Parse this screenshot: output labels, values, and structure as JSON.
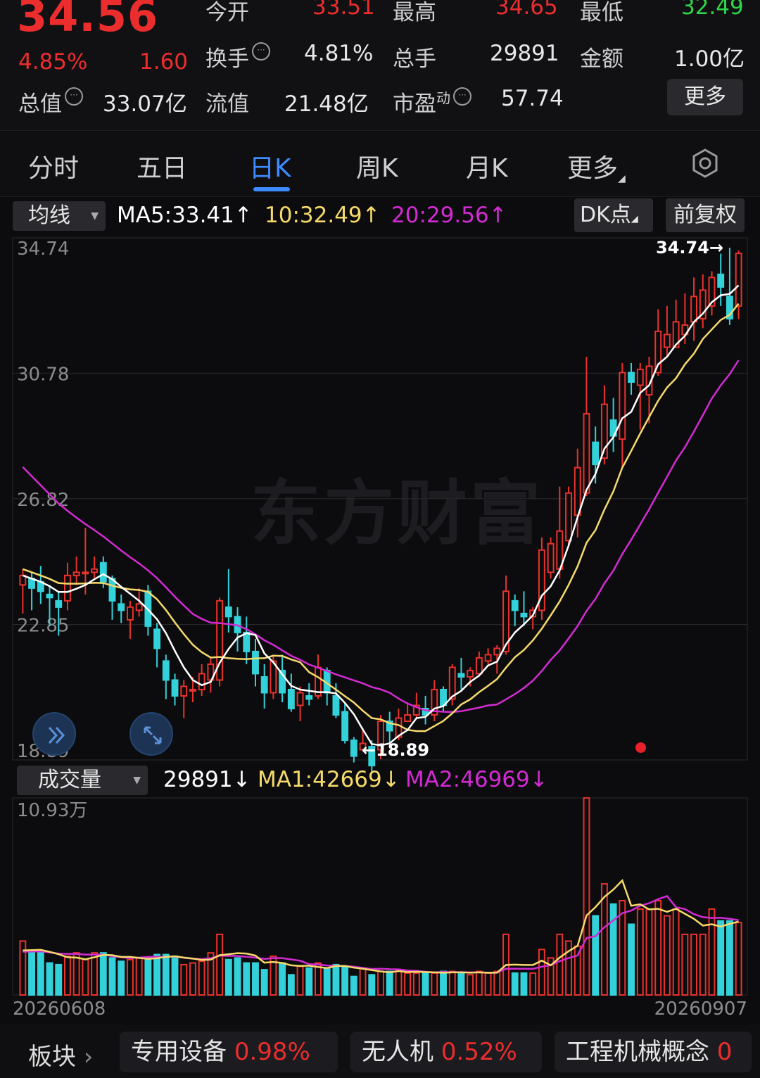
{
  "header": {
    "price": "34.56",
    "change_pct": "4.85%",
    "change": "1.60",
    "open_label": "今开",
    "open": "33.51",
    "high_label": "最高",
    "high": "34.65",
    "low_label": "最低",
    "low": "32.49",
    "turnover_label": "换手",
    "turnover": "4.81%",
    "volume_label": "总手",
    "volume": "29891",
    "amount_label": "金额",
    "amount": "1.00亿",
    "mktcap_label": "总值",
    "mktcap": "33.07亿",
    "float_label": "流值",
    "float": "21.48亿",
    "pe_label": "市盈",
    "pe_sup": "动",
    "pe": "57.74",
    "more": "更多",
    "colors": {
      "up": "#ec2d2d",
      "down": "#2fd64a"
    }
  },
  "tabs": [
    "分时",
    "五日",
    "日K",
    "周K",
    "月K",
    "更多"
  ],
  "active_tab": "日K",
  "indicator_bar": {
    "selector": "均线",
    "ma5": "MA5:33.41",
    "ma10": "10:32.49",
    "ma20": "20:29.56",
    "arrow_up": "↑",
    "dk_label": "DK点",
    "adjust_label": "前复权"
  },
  "watermark": "东方财富",
  "volume_bar": {
    "selector": "成交量",
    "vol": "29891",
    "ma1": "MA1:42669",
    "ma2": "MA2:46969",
    "arrow_down": "↓",
    "max_label": "10.93万"
  },
  "chart_data": {
    "type": "candlestick",
    "price_axis": {
      "ticks": [
        "34.74",
        "30.78",
        "26.82",
        "22.85",
        "18.89"
      ],
      "ylim": [
        18.89,
        34.74
      ]
    },
    "annotations": {
      "high": "34.74",
      "low": "18.89"
    },
    "x_start": "20260608",
    "x_end": "20260907",
    "colors": {
      "up": "#e8322c",
      "down": "#33d1d9",
      "ma5": "#ffffff",
      "ma10": "#f5da6b",
      "ma20": "#d32bd3",
      "vol_ma1": "#f5da6b",
      "vol_ma2": "#d32bd3"
    },
    "candles": [
      [
        24.1,
        24.4,
        24.6,
        23.2
      ],
      [
        24.3,
        24.0,
        24.5,
        23.3
      ],
      [
        24.2,
        23.9,
        24.7,
        23.5
      ],
      [
        23.8,
        23.7,
        24.1,
        22.8
      ],
      [
        23.6,
        23.4,
        23.9,
        22.5
      ],
      [
        23.6,
        24.4,
        24.8,
        23.3
      ],
      [
        24.4,
        24.5,
        25.0,
        24.1
      ],
      [
        24.5,
        24.5,
        25.9,
        23.8
      ],
      [
        24.5,
        24.6,
        25.0,
        24.3
      ],
      [
        24.8,
        24.2,
        25.0,
        24.0
      ],
      [
        24.3,
        23.6,
        24.4,
        23.0
      ],
      [
        23.5,
        23.3,
        23.8,
        22.9
      ],
      [
        23.0,
        23.4,
        23.6,
        22.4
      ],
      [
        23.3,
        23.5,
        24.0,
        23.1
      ],
      [
        23.9,
        22.8,
        24.1,
        22.5
      ],
      [
        22.7,
        22.1,
        22.9,
        21.5
      ],
      [
        21.7,
        21.1,
        21.9,
        20.5
      ],
      [
        21.1,
        20.6,
        21.3,
        20.3
      ],
      [
        20.6,
        20.9,
        21.1,
        19.9
      ],
      [
        20.8,
        20.8,
        21.2,
        20.4
      ],
      [
        20.8,
        21.3,
        21.6,
        20.6
      ],
      [
        21.1,
        21.6,
        21.8,
        20.7
      ],
      [
        21.1,
        23.6,
        23.7,
        20.9
      ],
      [
        23.4,
        23.1,
        24.6,
        22.6
      ],
      [
        23.1,
        22.6,
        23.4,
        22.0
      ],
      [
        22.6,
        22.0,
        23.1,
        21.6
      ],
      [
        22.0,
        21.3,
        22.4,
        20.9
      ],
      [
        21.2,
        20.7,
        21.6,
        20.2
      ],
      [
        20.7,
        21.7,
        21.9,
        20.5
      ],
      [
        21.4,
        20.7,
        21.9,
        20.4
      ],
      [
        20.8,
        20.2,
        21.3,
        20.1
      ],
      [
        20.3,
        20.7,
        20.9,
        19.8
      ],
      [
        20.6,
        20.5,
        21.0,
        20.3
      ],
      [
        20.6,
        21.5,
        21.9,
        20.5
      ],
      [
        21.4,
        20.7,
        21.5,
        20.3
      ],
      [
        20.6,
        20.0,
        21.0,
        19.9
      ],
      [
        20.1,
        19.2,
        20.4,
        19.1
      ],
      [
        19.2,
        18.7,
        19.3,
        18.5
      ],
      [
        18.9,
        19.1,
        19.6,
        18.89
      ],
      [
        19.0,
        18.4,
        19.2,
        18.2
      ],
      [
        18.9,
        19.8,
        20.0,
        18.6
      ],
      [
        19.8,
        19.5,
        20.1,
        19.1
      ],
      [
        19.3,
        19.9,
        20.2,
        19.2
      ],
      [
        19.8,
        20.0,
        20.4,
        19.8
      ],
      [
        20.0,
        20.3,
        20.7,
        19.9
      ],
      [
        20.2,
        20.0,
        20.6,
        19.7
      ],
      [
        20.0,
        20.8,
        21.1,
        19.8
      ],
      [
        20.8,
        20.3,
        20.9,
        20.1
      ],
      [
        20.5,
        21.5,
        21.6,
        20.3
      ],
      [
        21.3,
        21.2,
        21.8,
        20.8
      ],
      [
        21.2,
        21.4,
        21.5,
        20.9
      ],
      [
        21.3,
        21.8,
        22.0,
        21.2
      ],
      [
        21.7,
        21.9,
        22.1,
        21.6
      ],
      [
        21.9,
        22.1,
        22.2,
        21.3
      ],
      [
        22.0,
        23.9,
        24.4,
        21.9
      ],
      [
        23.6,
        23.3,
        23.8,
        22.8
      ],
      [
        23.2,
        23.1,
        23.9,
        22.8
      ],
      [
        23.1,
        23.3,
        23.4,
        22.7
      ],
      [
        23.3,
        25.2,
        25.6,
        23.0
      ],
      [
        24.5,
        25.4,
        25.6,
        24.3
      ],
      [
        24.6,
        25.8,
        27.2,
        24.3
      ],
      [
        25.5,
        27.0,
        27.2,
        25.3
      ],
      [
        26.3,
        27.8,
        28.4,
        25.6
      ],
      [
        27.0,
        29.5,
        31.3,
        26.9
      ],
      [
        28.6,
        27.9,
        29.1,
        27.3
      ],
      [
        28.1,
        29.8,
        30.4,
        27.9
      ],
      [
        29.3,
        28.8,
        30.0,
        28.3
      ],
      [
        28.7,
        30.8,
        31.1,
        27.8
      ],
      [
        30.8,
        30.5,
        31.1,
        30.1
      ],
      [
        30.4,
        30.9,
        31.1,
        29.0
      ],
      [
        30.1,
        31.0,
        31.3,
        29.2
      ],
      [
        30.8,
        32.1,
        32.8,
        30.7
      ],
      [
        31.6,
        32.0,
        32.9,
        31.3
      ],
      [
        31.6,
        32.4,
        33.1,
        31.7
      ],
      [
        32.0,
        32.3,
        33.3,
        31.7
      ],
      [
        32.4,
        33.2,
        33.8,
        31.8
      ],
      [
        32.5,
        33.4,
        33.9,
        32.2
      ],
      [
        32.9,
        33.8,
        34.0,
        32.6
      ],
      [
        33.9,
        33.5,
        34.55,
        32.9
      ],
      [
        33.2,
        32.5,
        34.74,
        32.3
      ],
      [
        32.9,
        34.56,
        34.65,
        32.49
      ]
    ],
    "volumes": [
      3.2,
      2.6,
      2.6,
      1.9,
      1.8,
      2.3,
      2.5,
      2.1,
      2.5,
      2.5,
      2.2,
      2.0,
      2.1,
      2.2,
      2.2,
      2.4,
      2.4,
      2.3,
      1.8,
      1.9,
      2.0,
      2.5,
      3.6,
      2.1,
      2.2,
      1.9,
      1.9,
      1.5,
      2.3,
      1.9,
      1.2,
      1.7,
      1.6,
      1.9,
      1.6,
      1.8,
      1.7,
      1.1,
      1.6,
      1.2,
      1.4,
      1.4,
      1.5,
      1.3,
      1.3,
      1.3,
      1.3,
      1.4,
      1.4,
      1.3,
      1.2,
      1.4,
      1.3,
      1.4,
      3.6,
      1.3,
      1.3,
      1.3,
      2.7,
      2.2,
      3.6,
      3.2,
      2.9,
      11.7,
      4.7,
      6.6,
      5.4,
      5.6,
      4.2,
      5.1,
      5.1,
      5.6,
      4.7,
      5.1,
      3.6,
      3.6,
      3.6,
      5.1,
      4.4,
      4.4,
      4.3
    ],
    "vol_max_label": "10.93万"
  },
  "sectors": {
    "label": "板块",
    "items": [
      {
        "name": "专用设备",
        "pct": "0.98%"
      },
      {
        "name": "无人机",
        "pct": "0.52%"
      },
      {
        "name": "工程机械概念",
        "pct": "0"
      }
    ]
  }
}
